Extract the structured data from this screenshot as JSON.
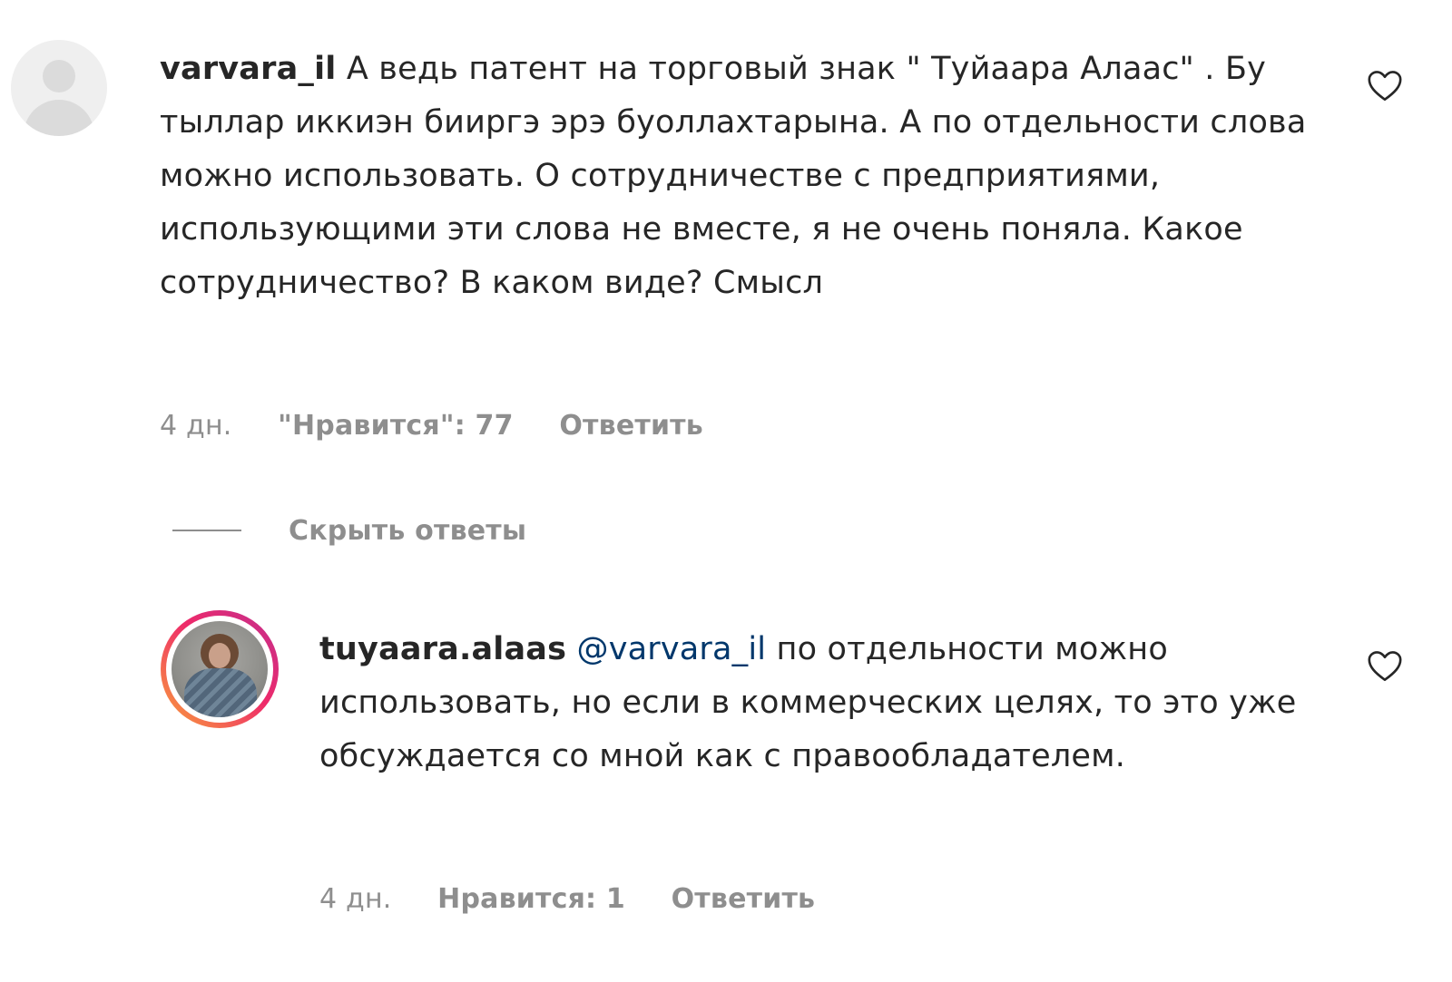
{
  "top_comment": {
    "username": "varvara_il",
    "text": "А ведь патент на торговый знак \" Туйаара Алаас\" . Бу тыллар иккиэн бииргэ эрэ буоллахтарына. А по отдельности слова можно использовать. О сотрудничестве с предприятиями, использующими эти слова не вместе, я не очень поняла. Какое сотрудничество? В каком виде? Смысл",
    "time": "4 дн.",
    "likes": "\"Нравится\": 77",
    "reply_label": "Ответить",
    "like_icon": "heart-outline"
  },
  "hide_replies_label": "Скрыть ответы",
  "reply_comment": {
    "username": "tuyaara.alaas",
    "mention": "@varvara_il",
    "text": "по отдельности можно использовать, но если в коммерческих целях, то это уже обсуждается со мной как с правообладателем.",
    "time": "4 дн.",
    "likes": "Нравится: 1",
    "reply_label": "Ответить",
    "like_icon": "heart-outline"
  },
  "colors": {
    "text": "#262626",
    "secondary": "#8e8e8e",
    "mention": "#00376b",
    "story_ring_start": "#f9a23a",
    "story_ring_end": "#c12f8f"
  }
}
